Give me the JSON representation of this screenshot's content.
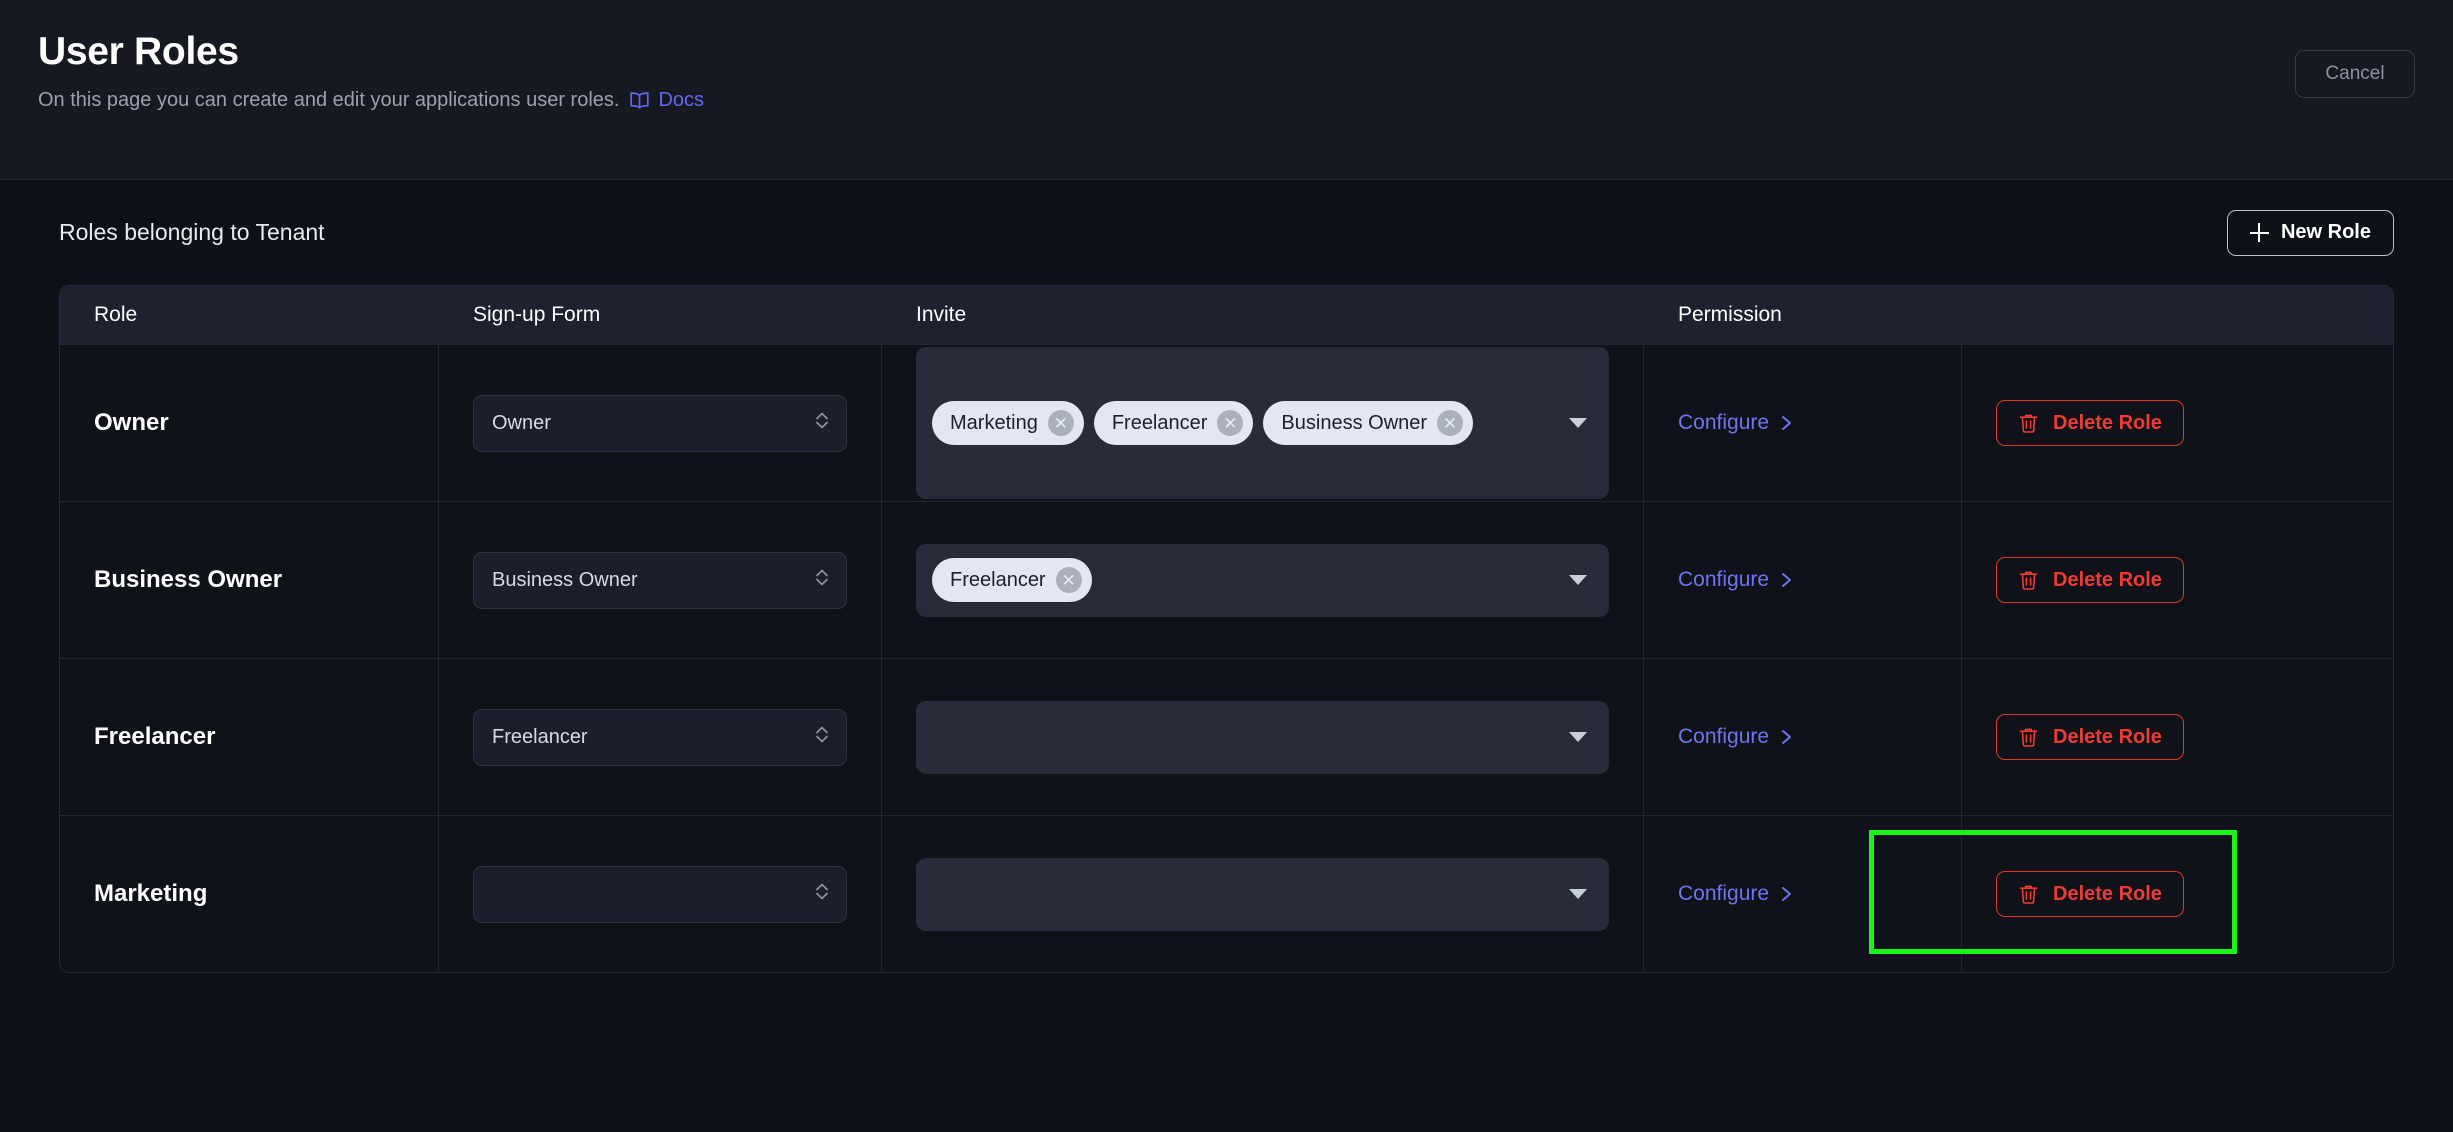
{
  "header": {
    "title": "User Roles",
    "subtitle": "On this page you can create and edit your applications user roles.",
    "docs_label": "Docs",
    "docs_icon": "book-open-icon",
    "cancel_label": "Cancel"
  },
  "section": {
    "title": "Roles belonging to Tenant",
    "new_role_label": "New Role",
    "new_role_icon": "plus-icon"
  },
  "table": {
    "columns": [
      "Role",
      "Sign-up Form",
      "Invite",
      "Permission",
      ""
    ],
    "rows": [
      {
        "role": "Owner",
        "signup_form": "Owner",
        "invites": [
          "Marketing",
          "Freelancer",
          "Business Owner"
        ],
        "permission_label": "Configure",
        "delete_label": "Delete Role"
      },
      {
        "role": "Business Owner",
        "signup_form": "Business Owner",
        "invites": [
          "Freelancer"
        ],
        "permission_label": "Configure",
        "delete_label": "Delete Role"
      },
      {
        "role": "Freelancer",
        "signup_form": "Freelancer",
        "invites": [],
        "permission_label": "Configure",
        "delete_label": "Delete Role"
      },
      {
        "role": "Marketing",
        "signup_form": "",
        "invites": [],
        "permission_label": "Configure",
        "delete_label": "Delete Role"
      }
    ]
  },
  "annotation": {
    "highlight_color": "#18f319",
    "target": "delete-role-button-marketing"
  },
  "colors": {
    "page_background": "#0d1016",
    "header_background": "#161922",
    "table_header_background": "#1e2130",
    "accent_link": "#6f74ef",
    "danger": "#ef3b33",
    "chip_background": "#e4e7f3"
  }
}
